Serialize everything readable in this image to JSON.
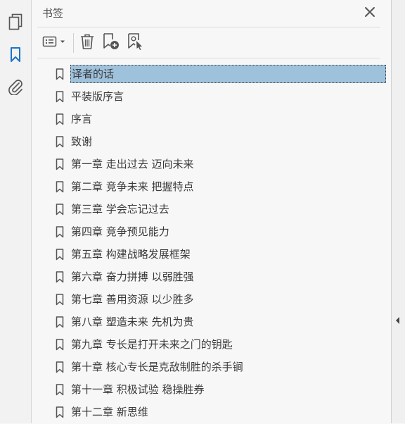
{
  "panel": {
    "title": "书签"
  },
  "rail": {
    "items": [
      "pages-icon",
      "bookmarks-icon",
      "attachments-icon"
    ]
  },
  "toolbar": {
    "items": [
      "options-menu-icon",
      "delete-icon",
      "new-bookmark-icon",
      "new-bookmark-from-structure-icon"
    ]
  },
  "bookmarks": [
    {
      "label": "译者的话",
      "selected": true
    },
    {
      "label": "平装版序言"
    },
    {
      "label": "序言"
    },
    {
      "label": "致谢"
    },
    {
      "label": "第一章 走出过去 迈向未来"
    },
    {
      "label": "第二章 竞争未来 把握特点"
    },
    {
      "label": "第三章 学会忘记过去"
    },
    {
      "label": "第四章 竞争预见能力"
    },
    {
      "label": "第五章 构建战略发展框架"
    },
    {
      "label": "第六章 奋力拼搏 以弱胜强"
    },
    {
      "label": "第七章 善用资源 以少胜多"
    },
    {
      "label": "第八章 塑造未来 先机为贵"
    },
    {
      "label": "第九章 专长是打开未来之门的钥匙"
    },
    {
      "label": "第十章 核心专长是克敌制胜的杀手锏"
    },
    {
      "label": "第十一章 积极试验 稳操胜券"
    },
    {
      "label": "第十二章 新思维"
    }
  ],
  "colors": {
    "selection": "#9fc2dc",
    "rail_active": "#1a73c8"
  }
}
